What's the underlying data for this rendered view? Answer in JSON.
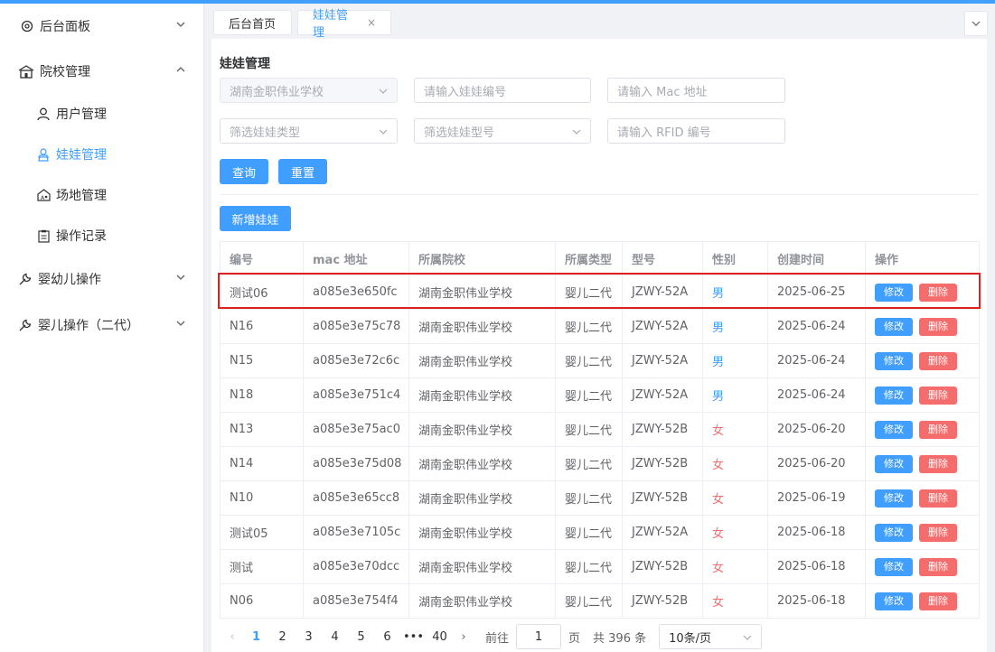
{
  "sidebar": {
    "items": [
      {
        "label": "后台面板",
        "icon": "dashboard-icon"
      },
      {
        "label": "院校管理",
        "icon": "school-icon"
      },
      {
        "label": "用户管理",
        "icon": "user-icon"
      },
      {
        "label": "娃娃管理",
        "icon": "doll-icon"
      },
      {
        "label": "场地管理",
        "icon": "venue-icon"
      },
      {
        "label": "操作记录",
        "icon": "clipboard-icon"
      },
      {
        "label": "婴幼儿操作",
        "icon": "wrench-icon"
      },
      {
        "label": "婴儿操作（二代）",
        "icon": "wrench-icon"
      }
    ]
  },
  "tabs": [
    {
      "label": "后台首页"
    },
    {
      "label": "娃娃管理",
      "close": "×"
    }
  ],
  "page": {
    "title": "娃娃管理",
    "filters": {
      "school_value": "湖南金职伟业学校",
      "doll_no_placeholder": "请输入娃娃编号",
      "mac_placeholder": "请输入 Mac 地址",
      "type_placeholder": "筛选娃娃类型",
      "model_placeholder": "筛选娃娃型号",
      "rfid_placeholder": "请输入 RFID 编号"
    },
    "buttons": {
      "query": "查询",
      "reset": "重置",
      "add": "新增娃娃"
    }
  },
  "table": {
    "columns": [
      "编号",
      "mac 地址",
      "所属院校",
      "所属类型",
      "型号",
      "性别",
      "创建时间",
      "操作"
    ],
    "edit_label": "修改",
    "delete_label": "删除",
    "rows": [
      {
        "no": "测试06",
        "mac": "a085e3e650fc",
        "school": "湖南金职伟业学校",
        "type": "婴儿二代",
        "model": "JZWY-52A",
        "gender": "男",
        "created": "2025-06-25"
      },
      {
        "no": "N16",
        "mac": "a085e3e75c78",
        "school": "湖南金职伟业学校",
        "type": "婴儿二代",
        "model": "JZWY-52A",
        "gender": "男",
        "created": "2025-06-24"
      },
      {
        "no": "N15",
        "mac": "a085e3e72c6c",
        "school": "湖南金职伟业学校",
        "type": "婴儿二代",
        "model": "JZWY-52A",
        "gender": "男",
        "created": "2025-06-24"
      },
      {
        "no": "N18",
        "mac": "a085e3e751c4",
        "school": "湖南金职伟业学校",
        "type": "婴儿二代",
        "model": "JZWY-52A",
        "gender": "男",
        "created": "2025-06-24"
      },
      {
        "no": "N13",
        "mac": "a085e3e75ac0",
        "school": "湖南金职伟业学校",
        "type": "婴儿二代",
        "model": "JZWY-52B",
        "gender": "女",
        "created": "2025-06-20"
      },
      {
        "no": "N14",
        "mac": "a085e3e75d08",
        "school": "湖南金职伟业学校",
        "type": "婴儿二代",
        "model": "JZWY-52B",
        "gender": "女",
        "created": "2025-06-20"
      },
      {
        "no": "N10",
        "mac": "a085e3e65cc8",
        "school": "湖南金职伟业学校",
        "type": "婴儿二代",
        "model": "JZWY-52B",
        "gender": "女",
        "created": "2025-06-19"
      },
      {
        "no": "测试05",
        "mac": "a085e3e7105c",
        "school": "湖南金职伟业学校",
        "type": "婴儿二代",
        "model": "JZWY-52A",
        "gender": "女",
        "created": "2025-06-18"
      },
      {
        "no": "测试",
        "mac": "a085e3e70dcc",
        "school": "湖南金职伟业学校",
        "type": "婴儿二代",
        "model": "JZWY-52B",
        "gender": "女",
        "created": "2025-06-18"
      },
      {
        "no": "N06",
        "mac": "a085e3e754f4",
        "school": "湖南金职伟业学校",
        "type": "婴儿二代",
        "model": "JZWY-52B",
        "gender": "女",
        "created": "2025-06-18"
      }
    ]
  },
  "pagination": {
    "pages": [
      "1",
      "2",
      "3",
      "4",
      "5",
      "6",
      "•••",
      "40"
    ],
    "current": "1",
    "goto_label": "前往",
    "goto_value": "1",
    "page_suffix": "页",
    "total": "共 396 条",
    "page_size": "10条/页"
  },
  "colors": {
    "accent": "#409eff",
    "danger": "#f56c6c",
    "highlight": "#e0201e"
  }
}
